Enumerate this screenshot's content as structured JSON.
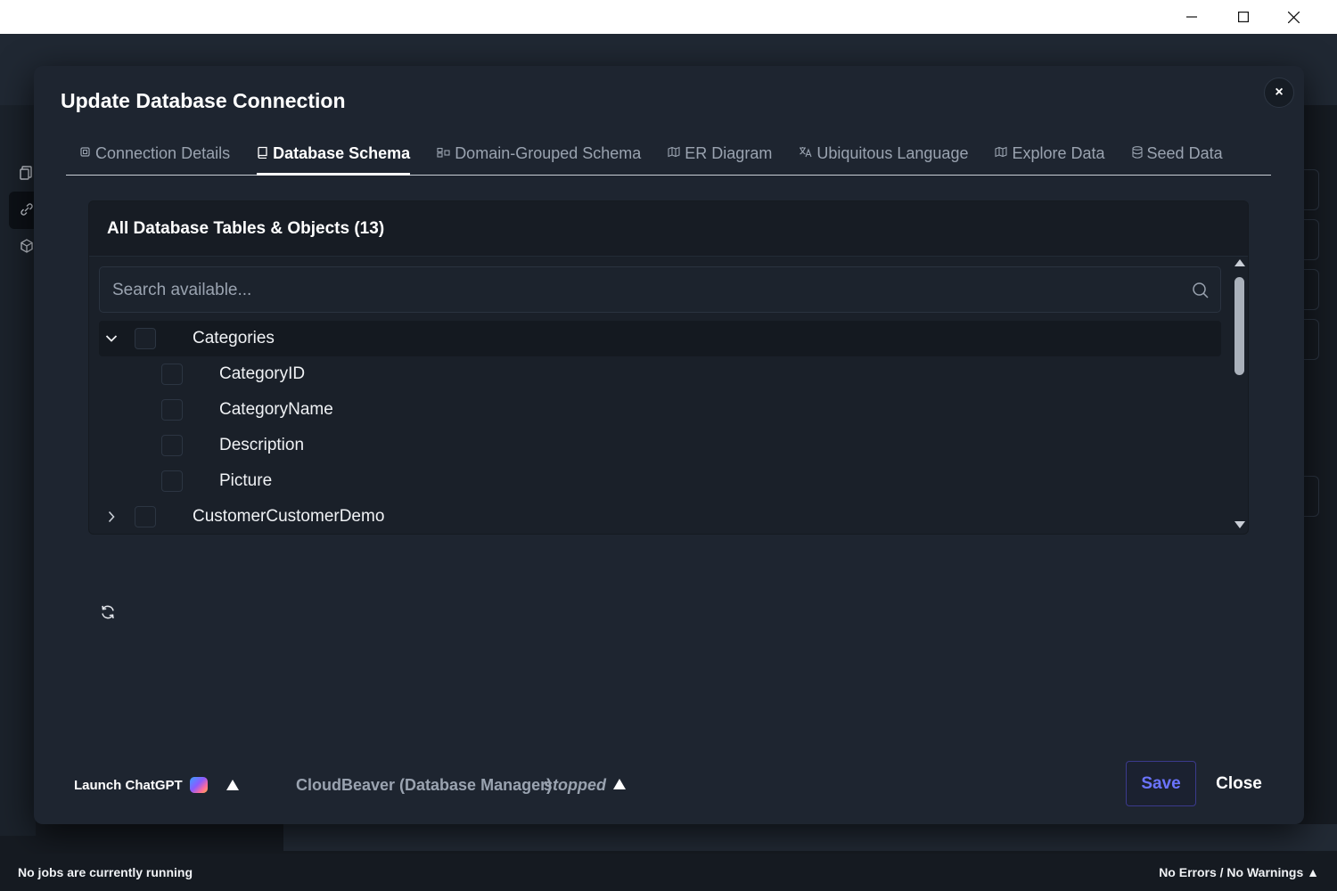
{
  "window": {
    "minimize_icon": "minimize-icon",
    "maximize_icon": "maximize-icon",
    "close_icon": "close-icon"
  },
  "modal": {
    "title": "Update Database Connection",
    "close_glyph": "×"
  },
  "tabs": [
    {
      "label": "Connection Details",
      "icon": "chip-icon",
      "active": false
    },
    {
      "label": "Database Schema",
      "icon": "book-icon",
      "active": true
    },
    {
      "label": "Domain-Grouped Schema",
      "icon": "group-icon",
      "active": false
    },
    {
      "label": "ER Diagram",
      "icon": "diagram-icon",
      "active": false
    },
    {
      "label": "Ubiquitous Language",
      "icon": "translate-icon",
      "active": false
    },
    {
      "label": "Explore Data",
      "icon": "map-icon",
      "active": false
    },
    {
      "label": "Seed Data",
      "icon": "database-icon",
      "active": false
    }
  ],
  "schema_panel": {
    "title": "All Database Tables & Objects (13)",
    "search_placeholder": "Search available...",
    "tree": [
      {
        "label": "Categories",
        "level": 0,
        "expanded": true
      },
      {
        "label": "CategoryID",
        "level": 1
      },
      {
        "label": "CategoryName",
        "level": 1
      },
      {
        "label": "Description",
        "level": 1
      },
      {
        "label": "Picture",
        "level": 1
      },
      {
        "label": "CustomerCustomerDemo",
        "level": 0,
        "expanded": false
      }
    ]
  },
  "footer": {
    "launch_label": "Launch ChatGPT",
    "cloudbeaver_name": "CloudBeaver (Database Manager)",
    "cloudbeaver_status": "stopped",
    "save_label": "Save",
    "close_label": "Close"
  },
  "statusbar": {
    "jobs": "No jobs are currently running",
    "errors": "No Errors / No Warnings ▲"
  },
  "colors": {
    "modal_bg": "#1e2530",
    "accent_save": "#6b74ff",
    "logo_accent": "#d9773f"
  }
}
